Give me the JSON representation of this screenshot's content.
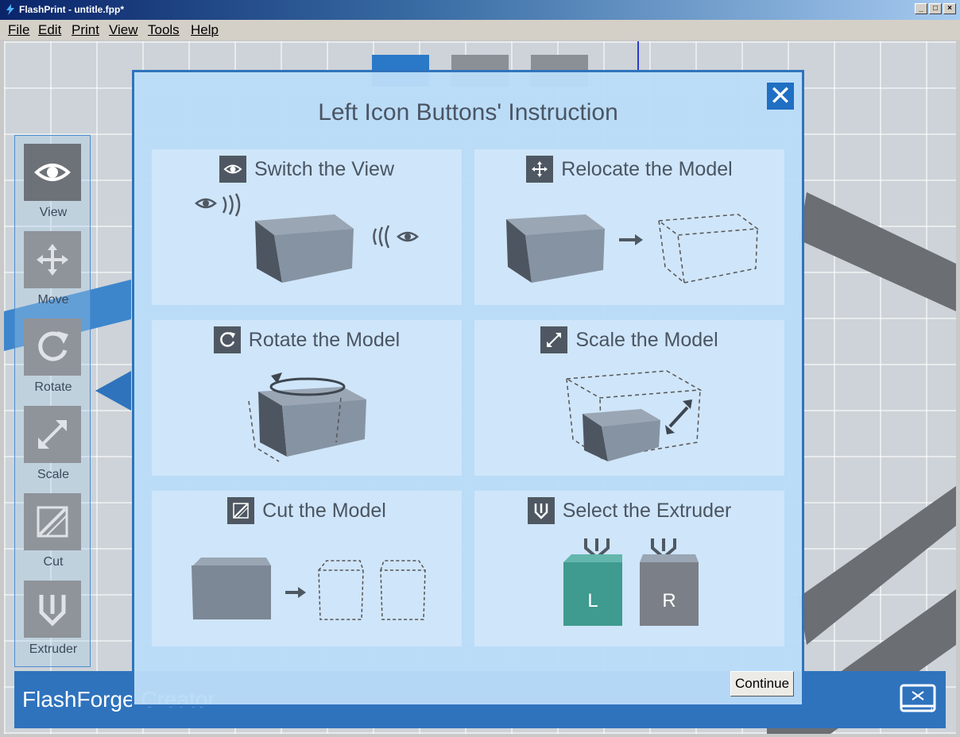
{
  "window": {
    "title": "FlashPrint - untitle.fpp*",
    "controls": [
      "_",
      "□",
      "×"
    ]
  },
  "menu": [
    "File",
    "Edit",
    "Print",
    "View",
    "Tools",
    "Help"
  ],
  "left_toolbar": [
    {
      "label": "View",
      "icon": "eye-icon"
    },
    {
      "label": "Move",
      "icon": "move-arrows-icon"
    },
    {
      "label": "Rotate",
      "icon": "rotate-icon"
    },
    {
      "label": "Scale",
      "icon": "scale-icon"
    },
    {
      "label": "Cut",
      "icon": "cut-icon"
    },
    {
      "label": "Extruder",
      "icon": "extruder-icon"
    }
  ],
  "bottom_bar": {
    "brand": "FlashForge Creator"
  },
  "modal": {
    "title": "Left Icon Buttons' Instruction",
    "close_label": "✕",
    "continue_label": "Continue",
    "cards": [
      {
        "title": "Switch the View",
        "icon": "eye-icon"
      },
      {
        "title": "Relocate the Model",
        "icon": "move-arrows-icon"
      },
      {
        "title": "Rotate the Model",
        "icon": "rotate-icon"
      },
      {
        "title": "Scale the Model",
        "icon": "scale-icon"
      },
      {
        "title": "Cut the Model",
        "icon": "cut-icon"
      },
      {
        "title": "Select the Extruder",
        "icon": "extruder-icon"
      }
    ],
    "extruder_labels": [
      "L",
      "R"
    ]
  },
  "colors": {
    "accent": "#2f73bd",
    "extruder_left": "#3f9a8f",
    "extruder_right": "#7b8088"
  }
}
